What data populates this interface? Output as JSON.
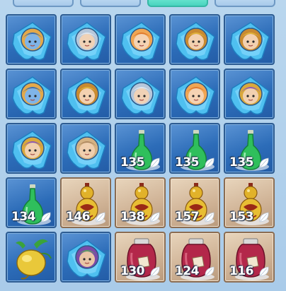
{
  "tabs": [
    {
      "name": "tab-1",
      "active": false
    },
    {
      "name": "tab-2",
      "active": false
    },
    {
      "name": "tab-3",
      "active": true
    },
    {
      "name": "tab-4",
      "active": false
    }
  ],
  "inventory": {
    "rows": [
      [
        {
          "item": "hero-card-blue-mask",
          "count": ""
        },
        {
          "item": "hero-card-winged-helm",
          "count": ""
        },
        {
          "item": "hero-card-orange-hair",
          "count": ""
        },
        {
          "item": "hero-card-gold-crown",
          "count": ""
        },
        {
          "item": "hero-card-gold-crown",
          "count": ""
        }
      ],
      [
        {
          "item": "hero-card-blue-mask",
          "count": ""
        },
        {
          "item": "hero-card-gold-crown",
          "count": ""
        },
        {
          "item": "hero-card-winged-helm",
          "count": ""
        },
        {
          "item": "hero-card-orange-hair",
          "count": ""
        },
        {
          "item": "hero-card-purple-crown",
          "count": ""
        }
      ],
      [
        {
          "item": "hero-card-purple-crown",
          "count": ""
        },
        {
          "item": "hero-card-tan-hair",
          "count": ""
        },
        {
          "item": "green-potion",
          "count": "135"
        },
        {
          "item": "green-potion",
          "count": "135"
        },
        {
          "item": "green-potion",
          "count": "135"
        }
      ],
      [
        {
          "item": "green-potion",
          "count": "134"
        },
        {
          "item": "golden-gourd",
          "count": "146"
        },
        {
          "item": "golden-gourd",
          "count": "138"
        },
        {
          "item": "golden-gourd",
          "count": "157"
        },
        {
          "item": "golden-gourd",
          "count": "153"
        }
      ],
      [
        {
          "item": "golden-fruit",
          "count": ""
        },
        {
          "item": "hero-card-green-hair",
          "count": ""
        },
        {
          "item": "wine-jar",
          "count": "130"
        },
        {
          "item": "wine-jar",
          "count": "124"
        },
        {
          "item": "wine-jar",
          "count": "116"
        }
      ]
    ]
  },
  "colors": {
    "slot_blue": "#2c6cb8",
    "slot_tan": "#cfb295",
    "tab_active": "#48d3bf",
    "background": "#b9d6ee"
  }
}
